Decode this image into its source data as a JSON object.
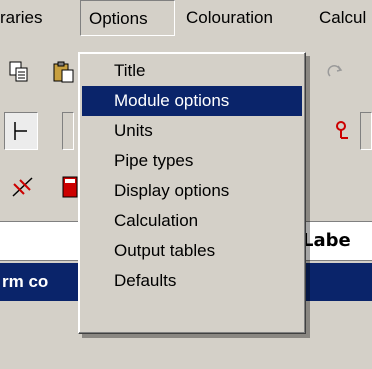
{
  "menubar": {
    "items": [
      {
        "label": "raries"
      },
      {
        "label": "Options"
      },
      {
        "label": "Colouration"
      },
      {
        "label": "Calcul"
      }
    ]
  },
  "options_menu": {
    "items": [
      {
        "label": "Title"
      },
      {
        "label": "Module options"
      },
      {
        "label": "Units"
      },
      {
        "label": "Pipe types"
      },
      {
        "label": "Display options"
      },
      {
        "label": "Calculation"
      },
      {
        "label": "Output tables"
      },
      {
        "label": "Defaults"
      }
    ],
    "highlighted": "Module options"
  },
  "partial_header": {
    "label": "Labe"
  },
  "partial_titlebar": {
    "label": "rm co"
  },
  "colors": {
    "highlight": "#0a246a",
    "face": "#d4d0c8"
  }
}
